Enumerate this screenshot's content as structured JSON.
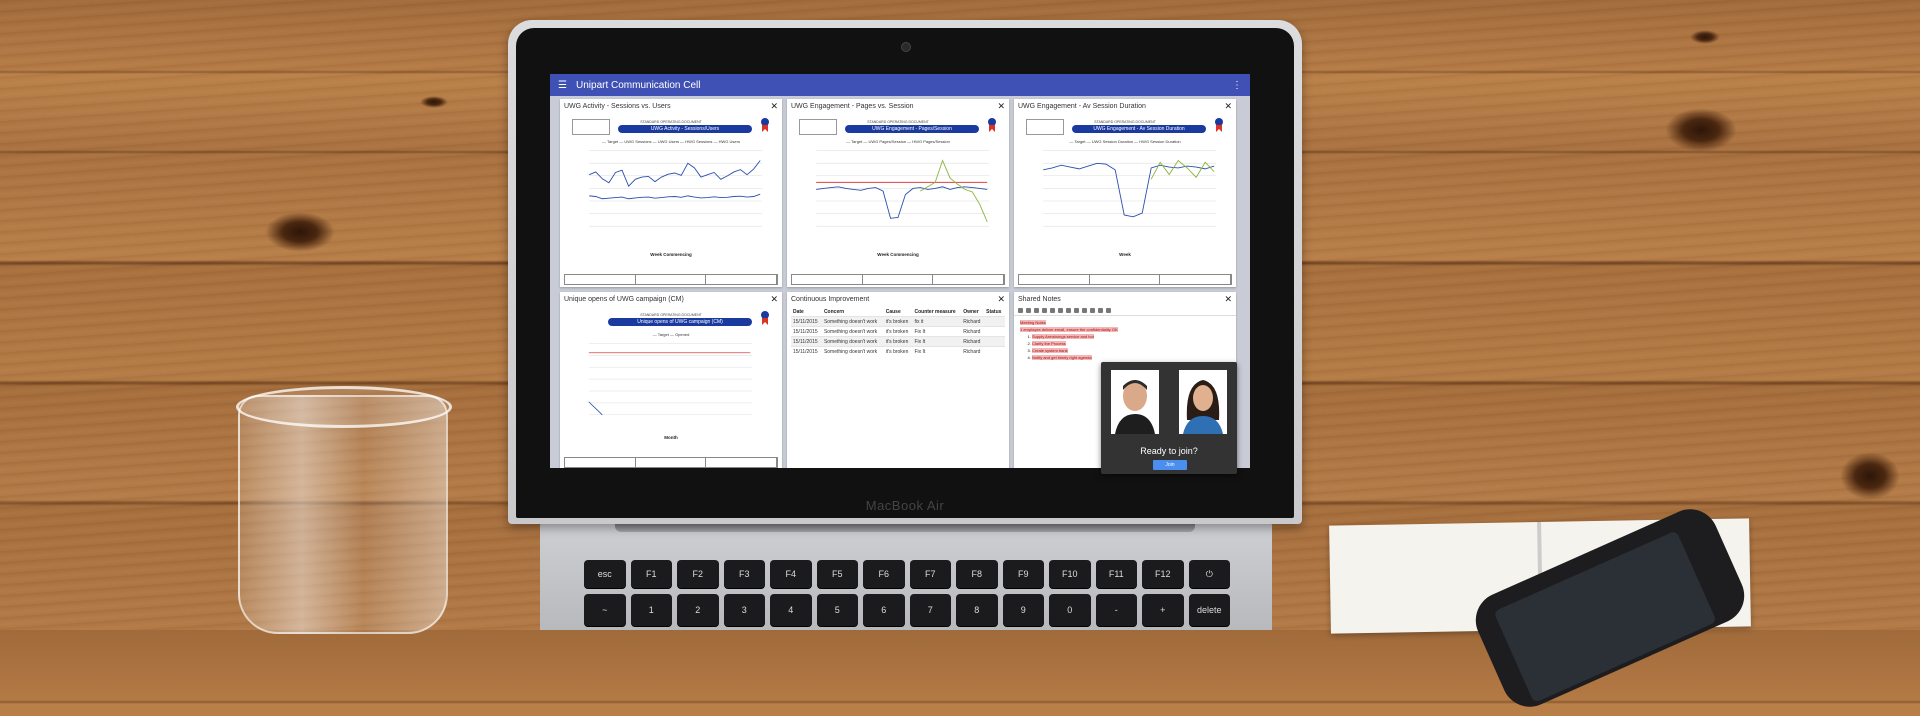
{
  "app": {
    "title": "Unipart Communication Cell"
  },
  "laptop": {
    "brand": "MacBook Air"
  },
  "cards": [
    {
      "title": "UWG Activity - Sessions vs. Users",
      "banner": "UWG Activity - Sessions/Users",
      "doc_label": "STANDARD OPERATING DOCUMENT",
      "legend": "— Target  — UWG Sessions  — UWG Users  — HWG Sessions  — HWG Users",
      "xlabel": "Week Commencing"
    },
    {
      "title": "UWG Engagement - Pages vs. Session",
      "banner": "UWG Engagement - Pages/Session",
      "doc_label": "STANDARD OPERATING DOCUMENT",
      "legend": "— Target  — UWG Pages/Session  — HWG Pages/Session",
      "xlabel": "Week Commencing"
    },
    {
      "title": "UWG Engagement - Av Session Duration",
      "banner": "UWG Engagement - Av Session Duration",
      "doc_label": "STANDARD OPERATING DOCUMENT",
      "legend": "— Target  — UWG Session Duration  — HWG Session Duration",
      "xlabel": "Week"
    },
    {
      "title": "Unique opens of UWG campaign (CM)",
      "banner": "Unique opens of UWG campaign (CM)",
      "doc_label": "STANDARD OPERATING DOCUMENT",
      "legend": "— Target  — Opened",
      "xlabel": "Month"
    }
  ],
  "ci": {
    "title": "Continuous Improvement",
    "headers": [
      "Date",
      "Concern",
      "Cause",
      "Counter measure",
      "Owner",
      "Status"
    ],
    "rows": [
      [
        "15/11/2015",
        "Something doesn't work",
        "it's broken",
        "fix it",
        "Richard",
        ""
      ],
      [
        "15/11/2015",
        "Something doesn't work",
        "it's broken",
        "Fix It",
        "Richard",
        ""
      ],
      [
        "15/11/2015",
        "Something doesn't work",
        "it's broken",
        "Fix It",
        "Richard",
        ""
      ],
      [
        "15/11/2015",
        "Something doesn't work",
        "it's broken",
        "Fix It",
        "Richard",
        ""
      ]
    ]
  },
  "notes": {
    "title": "Shared Notes",
    "heading": "Meeting Notes",
    "line1": "1 employee deliver email, ensure the confidentiality OK",
    "items": [
      "Supply Armstrongs service and hot",
      "Clarify the Process",
      "Create system bank",
      "Notify and get timely right agenda"
    ]
  },
  "join": {
    "ready": "Ready to join?",
    "button": "Join"
  },
  "chart_data": [
    {
      "type": "line",
      "title": "UWG Activity - Sessions/Users",
      "xlabel": "Week Commencing",
      "series": [
        {
          "name": "UWG Sessions",
          "values": [
            900,
            950,
            830,
            760,
            940,
            980,
            700,
            820,
            860,
            870,
            780,
            860,
            910,
            930,
            890,
            1100,
            1020,
            860,
            900,
            940,
            820,
            880,
            950,
            990,
            900,
            1000,
            1150
          ]
        },
        {
          "name": "UWG Users",
          "values": [
            530,
            520,
            480,
            490,
            500,
            510,
            480,
            495,
            505,
            510,
            490,
            500,
            515,
            520,
            505,
            530,
            510,
            495,
            500,
            515,
            500,
            505,
            520,
            525,
            510,
            520,
            560
          ]
        }
      ]
    },
    {
      "type": "line",
      "title": "UWG Engagement - Pages/Session",
      "xlabel": "Week Commencing",
      "series": [
        {
          "name": "Target",
          "values": [
            5,
            5,
            5,
            5,
            5,
            5,
            5,
            5,
            5,
            5,
            5,
            5,
            5,
            5,
            5,
            5,
            5,
            5,
            5,
            5,
            5,
            5,
            5,
            5
          ]
        },
        {
          "name": "UWG Pages/Session",
          "values": [
            4.2,
            4.3,
            4.4,
            4.5,
            4.3,
            4.2,
            4.1,
            4.3,
            4.4,
            4.0,
            0.9,
            1.0,
            3.6,
            4.3,
            4.4,
            4.2,
            4.3,
            4.5,
            4.2,
            4.4,
            4.5,
            4.4,
            4.3,
            4.2
          ]
        },
        {
          "name": "HWG Pages/Session",
          "values": [
            null,
            null,
            null,
            null,
            null,
            null,
            null,
            null,
            null,
            null,
            null,
            null,
            null,
            null,
            4.0,
            4.5,
            5.0,
            7.5,
            5.5,
            4.8,
            4.2,
            3.9,
            2.5,
            0.5
          ]
        }
      ]
    },
    {
      "type": "line",
      "title": "UWG Engagement - Av Session Duration",
      "xlabel": "Week",
      "series": [
        {
          "name": "UWG Session Duration",
          "values": [
            6,
            6.2,
            6.5,
            6.3,
            6.1,
            6.4,
            6.7,
            6.6,
            6.0,
            1.2,
            1.0,
            1.4,
            6.2,
            6.5,
            6.3,
            6.2,
            6.4,
            6.3,
            6.1,
            6.4
          ]
        },
        {
          "name": "HWG Session Duration",
          "values": [
            null,
            null,
            null,
            null,
            null,
            null,
            null,
            null,
            null,
            null,
            null,
            null,
            5.0,
            6.8,
            5.5,
            7.0,
            6.2,
            5.2,
            6.8,
            5.8
          ]
        }
      ]
    },
    {
      "type": "line",
      "title": "Unique opens of UWG campaign (CM)",
      "xlabel": "Month",
      "series": [
        {
          "name": "Target",
          "values": [
            2400,
            2400,
            2400,
            2400,
            2400,
            2400,
            2400,
            2400,
            2400,
            2400,
            2400,
            2400,
            2400
          ]
        },
        {
          "name": "Opened",
          "values": [
            500,
            0,
            null,
            null,
            null,
            null,
            null,
            null,
            null,
            null,
            null,
            null,
            null
          ]
        }
      ]
    }
  ],
  "colors": {
    "appbar": "#3f51b5",
    "banner": "#1b3aa0",
    "target": "#e04040",
    "uwg": "#2a4fae",
    "hwg": "#8ab43a"
  }
}
